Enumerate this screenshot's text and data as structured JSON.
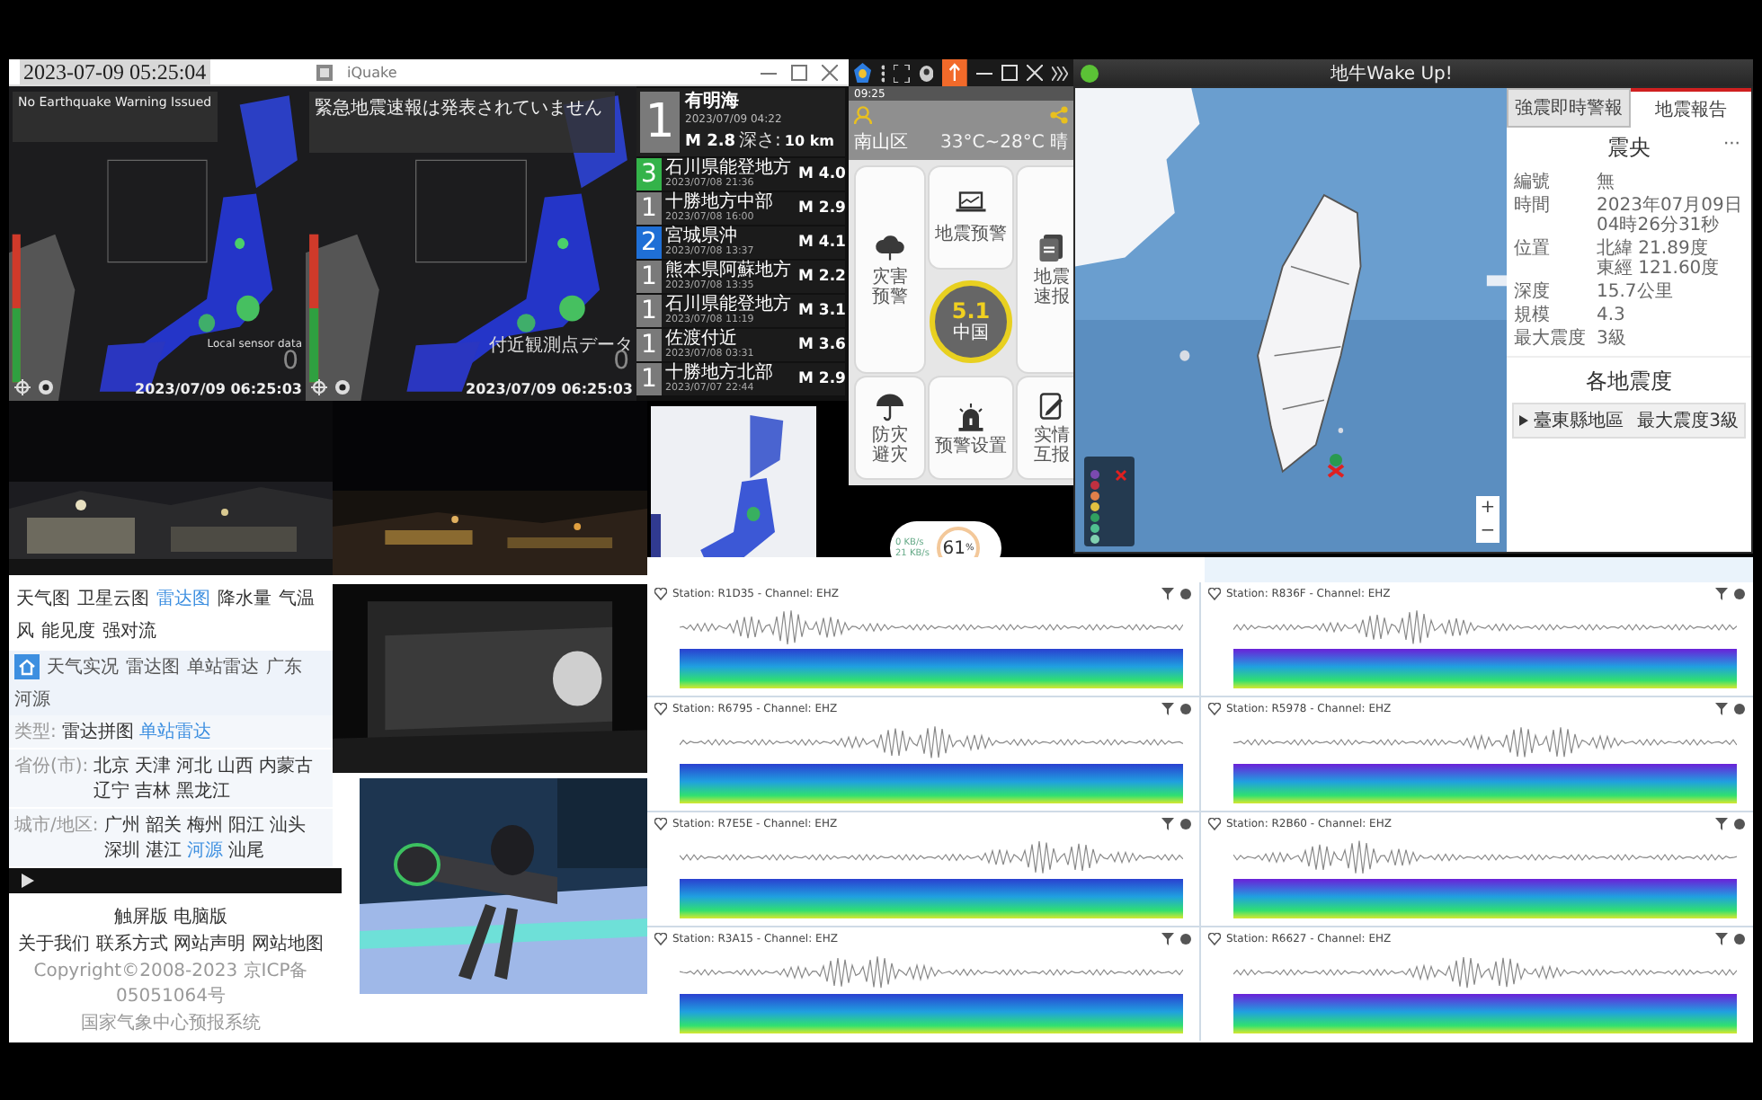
{
  "desktop_clock": "2023-07-09 05:25:04",
  "intensity_map": {
    "status": "No Earthquake Warning Issued",
    "sensor_label": "Local sensor data",
    "timestamp": "2023/07/09 06:25:03",
    "count": "0"
  },
  "iquake": {
    "title": "iQuake",
    "map": {
      "status": "緊急地震速報は発表されていません",
      "sensor_label": "付近観測点データ",
      "timestamp": "2023/07/09 06:25:03",
      "count": "0"
    },
    "latest": {
      "intensity": "1",
      "place": "有明海",
      "time": "2023/07/09 04:22",
      "magnitude": "M 2.8",
      "depth_label": "深さ:",
      "depth": "10 km"
    },
    "quakes": [
      {
        "intensity": "3",
        "color": "#34b34a",
        "place": "石川県能登地方",
        "time": "2023/07/08 21:36",
        "magnitude": "M 4.0"
      },
      {
        "intensity": "1",
        "color": "#7a7a7a",
        "place": "十勝地方中部",
        "time": "2023/07/08 16:00",
        "magnitude": "M 2.9"
      },
      {
        "intensity": "2",
        "color": "#1f6fd6",
        "place": "宮城県沖",
        "time": "2023/07/08 13:37",
        "magnitude": "M 4.1"
      },
      {
        "intensity": "1",
        "color": "#7a7a7a",
        "place": "熊本県阿蘇地方",
        "time": "2023/07/08 13:35",
        "magnitude": "M 2.2"
      },
      {
        "intensity": "1",
        "color": "#7a7a7a",
        "place": "石川県能登地方",
        "time": "2023/07/08 11:19",
        "magnitude": "M 3.1"
      },
      {
        "intensity": "1",
        "color": "#7a7a7a",
        "place": "佐渡付近",
        "time": "2023/07/08 03:31",
        "magnitude": "M 3.6"
      },
      {
        "intensity": "1",
        "color": "#7a7a7a",
        "place": "十勝地方北部",
        "time": "2023/07/07 22:44",
        "magnitude": "M 2.9"
      }
    ]
  },
  "phone_app": {
    "status_time": "09:25",
    "district": "南山区",
    "weather": "33°C~28°C 晴",
    "center_value": "5.1",
    "center_label": "中国",
    "tiles": [
      {
        "kind": "laptop",
        "label": "地震预警"
      },
      {
        "kind": "cloud",
        "label": "灾害预警"
      },
      {
        "kind": "document",
        "label": "地震速报"
      },
      {
        "kind": "umbrella",
        "label": "防灾避灾"
      },
      {
        "kind": "siren",
        "label": "预警设置"
      },
      {
        "kind": "note",
        "label": "实情互报"
      }
    ]
  },
  "network_widget": {
    "down": "0 KB/s",
    "up": "21 KB/s",
    "value": "61",
    "unit": "%"
  },
  "quake_app": {
    "title": "地牛Wake Up!",
    "tabs": [
      {
        "label": "強震即時警報",
        "selected": false
      },
      {
        "label": "地震報告",
        "selected": true
      }
    ],
    "section": "震央",
    "more": "···",
    "fields": [
      {
        "label": "編號",
        "lines": [
          "無"
        ]
      },
      {
        "label": "時間",
        "lines": [
          "2023年07月09日",
          "04時26分31秒"
        ]
      },
      {
        "label": "位置",
        "lines": [
          "北緯 21.89度",
          "東經 121.60度"
        ]
      },
      {
        "label": "深度",
        "lines": [
          "15.7公里"
        ]
      },
      {
        "label": "規模",
        "lines": [
          "4.3"
        ]
      },
      {
        "label": "最大震度",
        "lines": [
          "3級"
        ]
      }
    ],
    "regions_title": "各地震度",
    "regions": [
      {
        "name": "臺東縣地區",
        "max": "最大震度3級",
        "expanded": false
      }
    ],
    "zoom": [
      "+",
      "−"
    ]
  },
  "weather_site": {
    "nav": [
      {
        "label": "天气图",
        "selected": false
      },
      {
        "label": "卫星云图",
        "selected": false
      },
      {
        "label": "雷达图",
        "selected": true
      },
      {
        "label": "降水量",
        "selected": false
      },
      {
        "label": "气温",
        "selected": false
      },
      {
        "label": "风",
        "selected": false
      },
      {
        "label": "能见度",
        "selected": false
      },
      {
        "label": "强对流",
        "selected": false
      }
    ],
    "subnav": [
      "天气实况",
      "雷达图",
      "单站雷达",
      "广东",
      "河源"
    ],
    "filters": [
      {
        "label": "类型:",
        "options": [
          {
            "label": "雷达拼图",
            "selected": false
          },
          {
            "label": "单站雷达",
            "selected": true
          }
        ]
      },
      {
        "label": "省份(市):",
        "options": [
          {
            "label": "北京",
            "selected": false
          },
          {
            "label": "天津",
            "selected": false
          },
          {
            "label": "河北",
            "selected": false
          },
          {
            "label": "山西",
            "selected": false
          },
          {
            "label": "内蒙古",
            "selected": false
          },
          {
            "label": "辽宁",
            "selected": false
          },
          {
            "label": "吉林",
            "selected": false
          },
          {
            "label": "黑龙江",
            "selected": false
          }
        ]
      },
      {
        "label": "城市/地区:",
        "options": [
          {
            "label": "广州",
            "selected": false
          },
          {
            "label": "韶关",
            "selected": false
          },
          {
            "label": "梅州",
            "selected": false
          },
          {
            "label": "阳江",
            "selected": false
          },
          {
            "label": "汕头",
            "selected": false
          },
          {
            "label": "深圳",
            "selected": false
          },
          {
            "label": "湛江",
            "selected": false
          },
          {
            "label": "河源",
            "selected": true
          },
          {
            "label": "汕尾",
            "selected": false
          }
        ]
      }
    ],
    "footer": [
      "触屏版 电脑版",
      "关于我们 联系方式 网站声明 网站地图",
      "Copyright©2008-2023 京ICP备05051064号",
      "国家气象中心预报系统"
    ]
  },
  "seismographs": [
    {
      "station": "Station: R1D35 - Channel: EHZ"
    },
    {
      "station": "Station: R836F - Channel: EHZ"
    },
    {
      "station": "Station: R6795 - Channel: EHZ"
    },
    {
      "station": "Station: R5978 - Channel: EHZ"
    },
    {
      "station": "Station: R7E5E - Channel: EHZ"
    },
    {
      "station": "Station: R2B60 - Channel: EHZ"
    },
    {
      "station": "Station: R3A15 - Channel: EHZ"
    },
    {
      "station": "Station: R6627 - Channel: EHZ"
    }
  ]
}
